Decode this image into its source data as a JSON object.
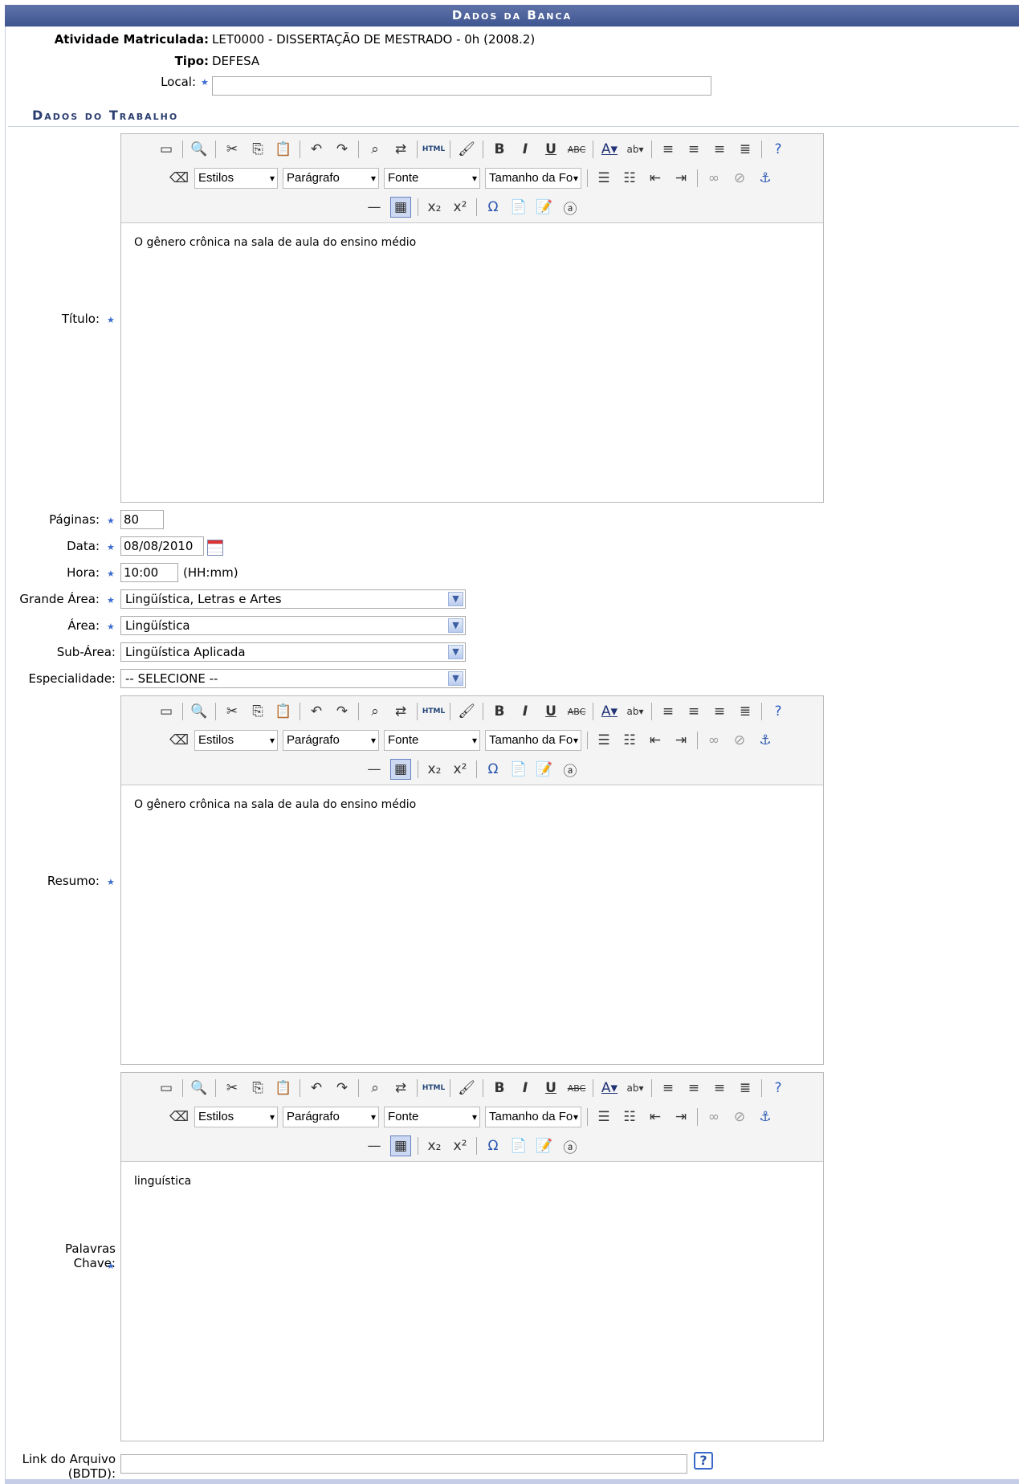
{
  "header": {
    "title": "Dados da Banca"
  },
  "atividade": {
    "label": "Atividade Matriculada:",
    "value": "LET0000 - DISSERTAÇÃO DE MESTRADO - 0h (2008.2)"
  },
  "tipo": {
    "label": "Tipo:",
    "value": "DEFESA"
  },
  "local": {
    "label": "Local:",
    "value": ""
  },
  "section_title": "Dados do Trabalho",
  "editor_toolbar": {
    "estilos": "Estilos",
    "paragrafo": "Parágrafo",
    "fonte": "Fonte",
    "tamanho": "Tamanho da Fo"
  },
  "titulo": {
    "label": "Título:",
    "content": "O gênero crônica na sala de aula do ensino médio"
  },
  "paginas": {
    "label": "Páginas:",
    "value": "80"
  },
  "data": {
    "label": "Data:",
    "value": "08/08/2010"
  },
  "hora": {
    "label": "Hora:",
    "value": "10:00",
    "hint": "(HH:mm)"
  },
  "grande_area": {
    "label": "Grande Área:",
    "value": "Lingüística, Letras e Artes"
  },
  "area": {
    "label": "Área:",
    "value": "Lingüística"
  },
  "sub_area": {
    "label": "Sub-Área:",
    "value": "Lingüística Aplicada"
  },
  "especialidade": {
    "label": "Especialidade:",
    "value": "-- SELECIONE --"
  },
  "resumo": {
    "label": "Resumo:",
    "content": "O gênero crônica na sala de aula do ensino médio"
  },
  "palavras_chave": {
    "label_line1": "Palavras",
    "label_line2": "Chave:",
    "content": "linguística"
  },
  "link_arquivo": {
    "label_line1": "Link do Arquivo",
    "label_line2": "(BDTD):",
    "value": ""
  },
  "colors": {
    "header_bg": "#4a5f9a",
    "section_text": "#2b3e70",
    "required_star": "#3a6bd1"
  }
}
